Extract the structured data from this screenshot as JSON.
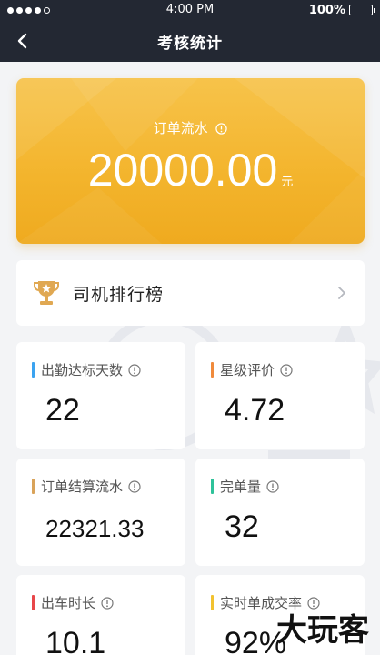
{
  "status_bar": {
    "time": "4:00 PM",
    "battery": "100%"
  },
  "nav": {
    "title": "考核统计"
  },
  "hero": {
    "label": "订单流水",
    "value": "20000.00",
    "unit": "元"
  },
  "ranking": {
    "label": "司机排行榜"
  },
  "stats": [
    {
      "label": "出勤达标天数",
      "value": "22",
      "color": "#3ba3f0"
    },
    {
      "label": "星级评价",
      "value": "4.72",
      "color": "#f08a3c"
    },
    {
      "label": "订单结算流水",
      "value": "22321.33",
      "color": "#d9a35a"
    },
    {
      "label": "完单量",
      "value": "32",
      "color": "#2ec29a"
    },
    {
      "label": "出车时长",
      "value": "10.1",
      "color": "#e8474a"
    },
    {
      "label": "实时单成交率",
      "value": "92%",
      "color": "#f2c230"
    }
  ],
  "watermark": "大玩客"
}
